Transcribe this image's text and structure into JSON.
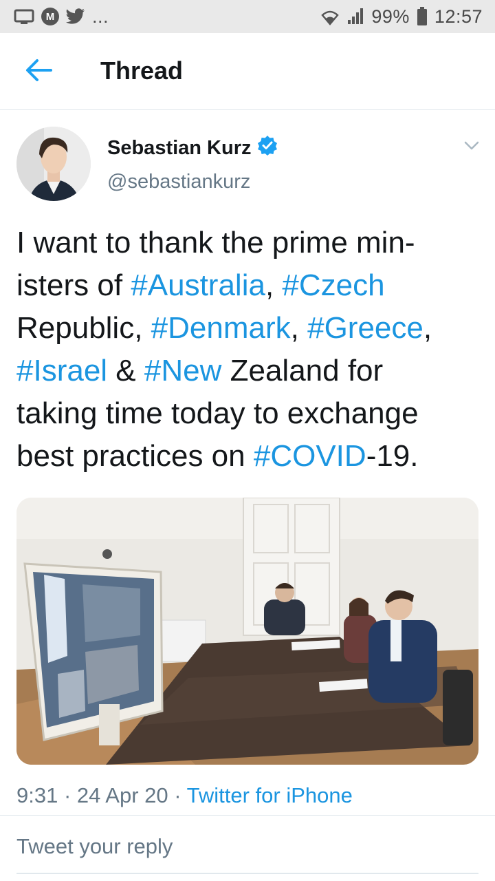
{
  "status_bar": {
    "overflow_dots": "...",
    "m_badge": "M",
    "battery_percent": "99%",
    "time": "12:57"
  },
  "header": {
    "title": "Thread"
  },
  "tweet": {
    "author_name": "Sebastian Kurz",
    "handle": "@sebastiankurz",
    "verified": true,
    "text_lines": [
      [
        {
          "t": "I want to thank the prime min-",
          "h": false
        }
      ],
      [
        {
          "t": "isters of ",
          "h": false
        },
        {
          "t": "#Australia",
          "h": true
        },
        {
          "t": ", ",
          "h": false
        },
        {
          "t": "#Czech",
          "h": true
        }
      ],
      [
        {
          "t": "Republic, ",
          "h": false
        },
        {
          "t": "#Denmark",
          "h": true
        },
        {
          "t": ", ",
          "h": false
        },
        {
          "t": "#Greece",
          "h": true
        },
        {
          "t": ",",
          "h": false
        }
      ],
      [
        {
          "t": "#Israel",
          "h": true
        },
        {
          "t": " & ",
          "h": false
        },
        {
          "t": "#New",
          "h": true
        },
        {
          "t": " Zealand for",
          "h": false
        }
      ],
      [
        {
          "t": "taking time today to exchange",
          "h": false
        }
      ],
      [
        {
          "t": "best practices on ",
          "h": false
        },
        {
          "t": "#COVID",
          "h": true
        },
        {
          "t": "-19.",
          "h": false
        }
      ]
    ],
    "time": "9:31",
    "date": "24 Apr 20",
    "source": "Twitter for iPhone",
    "separator": " · "
  },
  "reply": {
    "placeholder": "Tweet your reply"
  },
  "colors": {
    "link": "#1b95e0",
    "verified_badge": "#1da1f2",
    "secondary_text": "#657786",
    "status_bar_bg": "#e9e9e9"
  },
  "icons": {
    "back": "arrow-left-icon",
    "verified": "verified-badge-icon",
    "more": "chevron-down-icon",
    "screen": "screen-cast-icon",
    "twitter": "twitter-bird-icon",
    "wifi": "wifi-icon",
    "signal": "signal-icon",
    "battery": "battery-icon"
  }
}
